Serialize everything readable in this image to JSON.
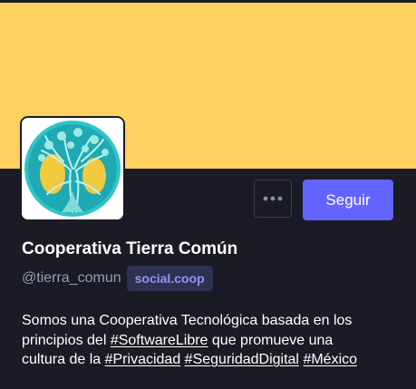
{
  "profile": {
    "display_name": "Cooperativa Tierra Común",
    "username": "@tierra_comun",
    "domain": "social.coop",
    "follow_label": "Seguir",
    "more_icon": "ellipsis-icon",
    "avatar_icon": "tree-logo-icon",
    "bio": {
      "line1": "Somos una Cooperativa Tecnológica basada en los",
      "line2_prefix": "principios del ",
      "tag_software": "#SoftwareLibre",
      "line2_suffix": " que promueve una",
      "line3_prefix": "cultura de la ",
      "tag_privacidad": "#Privacidad",
      "tag_seguridad": "#SeguridadDigital",
      "tag_mexico": "#México"
    }
  },
  "colors": {
    "banner": "#ffd15e",
    "background": "#1a1b24",
    "accent": "#6364ff",
    "badge_bg": "#2f3152",
    "badge_text": "#8f95f2",
    "muted_text": "#9a9cb3",
    "logo_teal": "#2ec4c8",
    "logo_yellow": "#f3c93f"
  }
}
